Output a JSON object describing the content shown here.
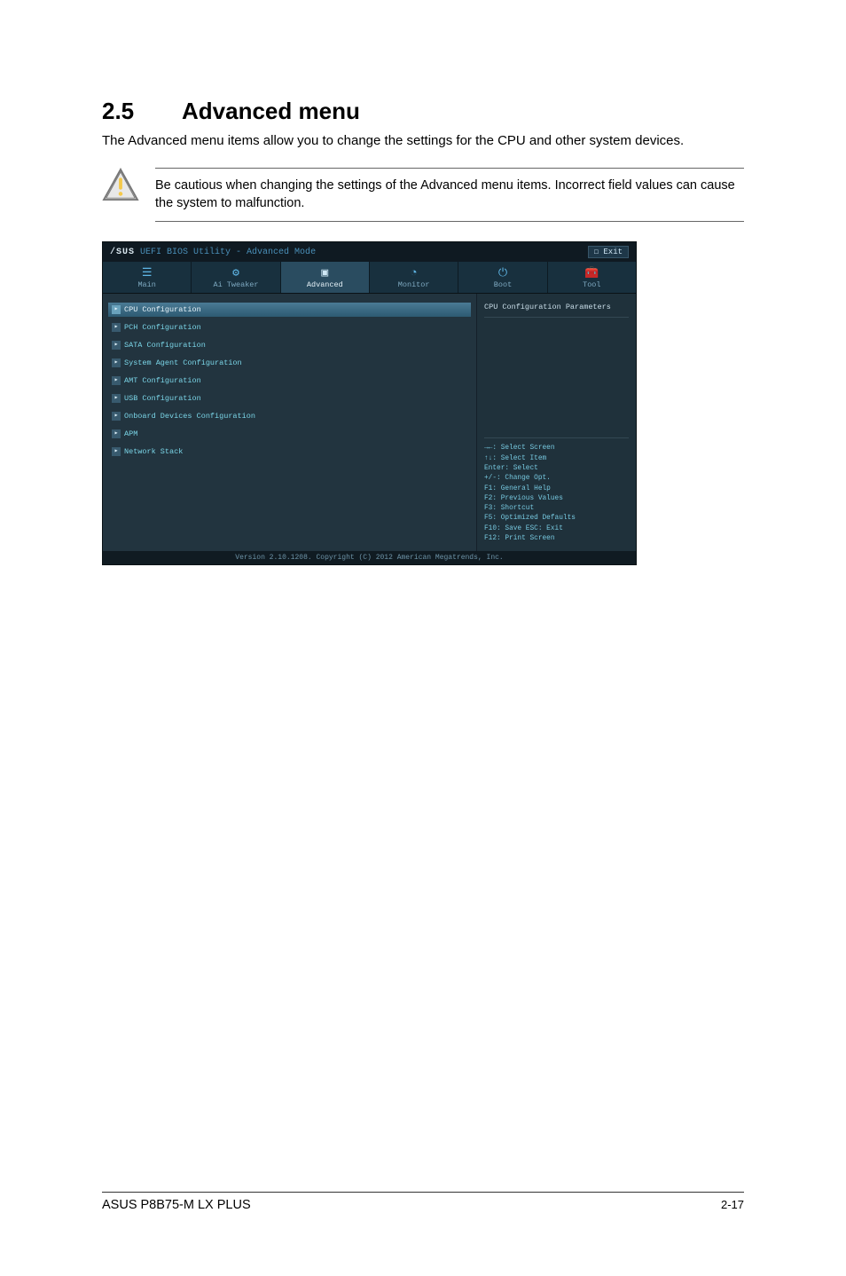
{
  "heading_number": "2.5",
  "heading_title": "Advanced menu",
  "intro": "The Advanced menu items allow you to change the settings for the CPU and other system devices.",
  "caution": "Be cautious when changing the settings of the Advanced menu items. Incorrect field values can cause the system to malfunction.",
  "bios": {
    "brand": "/SUS",
    "title_suffix": "UEFI BIOS Utility - Advanced Mode",
    "exit_label": "Exit",
    "tabs": [
      {
        "icon": "☰",
        "label": "Main"
      },
      {
        "icon": "⚙",
        "label": "Ai Tweaker"
      },
      {
        "icon": "▣",
        "label": "Advanced"
      },
      {
        "icon": "◔",
        "label": "Monitor"
      },
      {
        "icon": "⏻",
        "label": "Boot"
      },
      {
        "icon": "🧰",
        "label": "Tool"
      }
    ],
    "active_tab_index": 2,
    "items": [
      "CPU Configuration",
      "PCH Configuration",
      "SATA Configuration",
      "System Agent Configuration",
      "AMT Configuration",
      "USB Configuration",
      "Onboard Devices Configuration",
      "APM",
      "Network Stack"
    ],
    "selected_item_index": 0,
    "help_title": "CPU Configuration Parameters",
    "key_hints": [
      "→←: Select Screen",
      "↑↓: Select Item",
      "Enter: Select",
      "+/-: Change Opt.",
      "F1: General Help",
      "F2: Previous Values",
      "F3: Shortcut",
      "F5: Optimized Defaults",
      "F10: Save  ESC: Exit",
      "F12: Print Screen"
    ],
    "footer": "Version 2.10.1208. Copyright (C) 2012 American Megatrends, Inc."
  },
  "footer_model": "ASUS P8B75-M LX PLUS",
  "footer_page": "2-17"
}
